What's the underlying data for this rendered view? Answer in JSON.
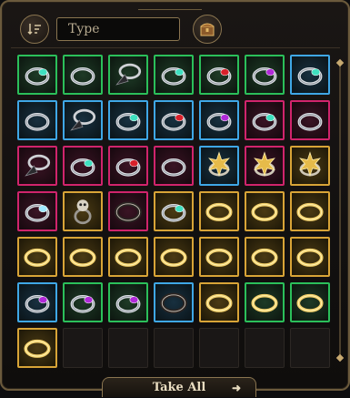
{
  "search": {
    "placeholder": "Type"
  },
  "footer": {
    "take_all_label": "Take All",
    "take_all_icon": "arrow-right-icon"
  },
  "colors": {
    "uncommon": "#2bbf5a",
    "rare": "#3fa7e6",
    "very_rare": "#d0246c",
    "gold": "#d8a437"
  },
  "slots": [
    {
      "rarity": "green",
      "item": "ring-silver-teal"
    },
    {
      "rarity": "green",
      "item": "ring-silver"
    },
    {
      "rarity": "green",
      "item": "ring-spiked-dark"
    },
    {
      "rarity": "green",
      "item": "ring-silver-teal"
    },
    {
      "rarity": "green",
      "item": "ring-silver-red"
    },
    {
      "rarity": "green",
      "item": "ring-silver-purple"
    },
    {
      "rarity": "blue",
      "item": "ring-silver-teal"
    },
    {
      "rarity": "blue",
      "item": "ring-silver"
    },
    {
      "rarity": "blue",
      "item": "ring-spiked-dark"
    },
    {
      "rarity": "blue",
      "item": "ring-silver-teal"
    },
    {
      "rarity": "blue",
      "item": "ring-silver-red"
    },
    {
      "rarity": "blue",
      "item": "ring-silver-purple"
    },
    {
      "rarity": "magenta",
      "item": "ring-silver-teal"
    },
    {
      "rarity": "magenta",
      "item": "ring-silver"
    },
    {
      "rarity": "magenta",
      "item": "ring-spiked-dark"
    },
    {
      "rarity": "magenta",
      "item": "ring-silver-teal"
    },
    {
      "rarity": "magenta",
      "item": "ring-silver-red"
    },
    {
      "rarity": "magenta",
      "item": "ring-silver"
    },
    {
      "rarity": "blue",
      "item": "ring-star-gold"
    },
    {
      "rarity": "magenta",
      "item": "ring-star-gold"
    },
    {
      "rarity": "gold",
      "item": "ring-star-gold"
    },
    {
      "rarity": "magenta",
      "item": "ring-silver-glow"
    },
    {
      "rarity": "gold",
      "item": "ring-skull"
    },
    {
      "rarity": "magenta",
      "item": "ring-dark-band"
    },
    {
      "rarity": "gold",
      "item": "ring-silver-teal"
    },
    {
      "rarity": "gold",
      "item": "ring-gold-band"
    },
    {
      "rarity": "gold",
      "item": "ring-gold-band"
    },
    {
      "rarity": "gold",
      "item": "ring-gold-band"
    },
    {
      "rarity": "gold",
      "item": "ring-gold-band"
    },
    {
      "rarity": "gold",
      "item": "ring-gold-band"
    },
    {
      "rarity": "gold",
      "item": "ring-gold-band"
    },
    {
      "rarity": "gold",
      "item": "ring-gold-band"
    },
    {
      "rarity": "gold",
      "item": "ring-gold-band"
    },
    {
      "rarity": "gold",
      "item": "ring-gold-band"
    },
    {
      "rarity": "gold",
      "item": "ring-gold-band"
    },
    {
      "rarity": "blue",
      "item": "ring-silver-purple"
    },
    {
      "rarity": "green",
      "item": "ring-silver-purple"
    },
    {
      "rarity": "green",
      "item": "ring-silver-purple"
    },
    {
      "rarity": "blue",
      "item": "ring-dark-band"
    },
    {
      "rarity": "gold",
      "item": "ring-gold-band"
    },
    {
      "rarity": "green",
      "item": "ring-gold-band"
    },
    {
      "rarity": "green",
      "item": "ring-gold-band"
    },
    {
      "rarity": "gold",
      "item": "ring-gold-band"
    },
    {
      "rarity": "empty",
      "item": ""
    },
    {
      "rarity": "empty",
      "item": ""
    },
    {
      "rarity": "empty",
      "item": ""
    },
    {
      "rarity": "empty",
      "item": ""
    },
    {
      "rarity": "empty",
      "item": ""
    },
    {
      "rarity": "empty",
      "item": ""
    }
  ]
}
